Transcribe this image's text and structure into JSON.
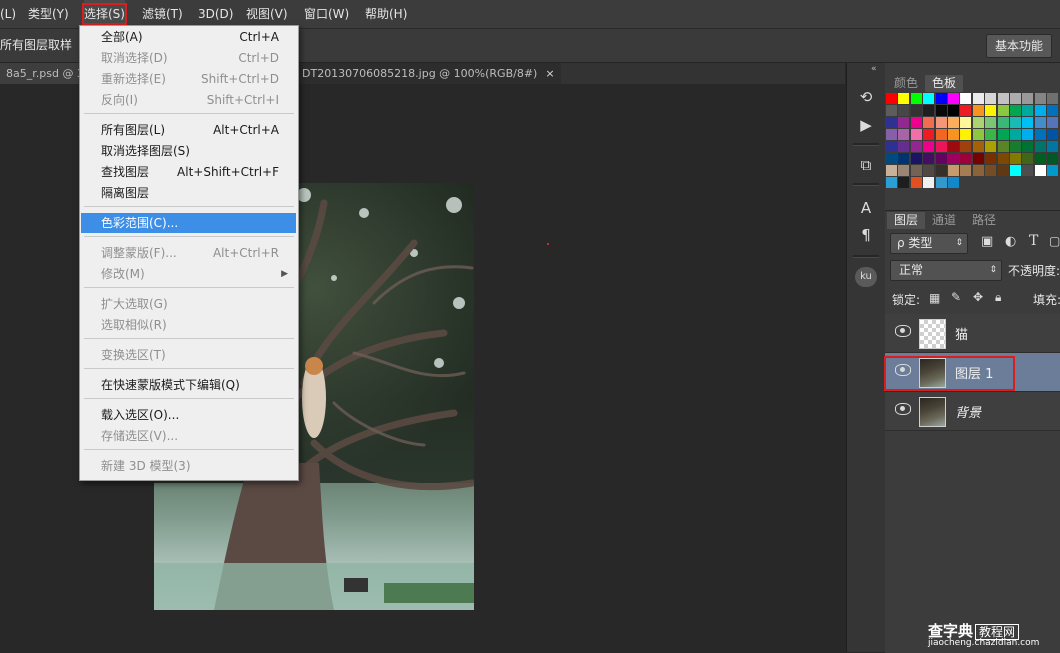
{
  "menubar": {
    "items": [
      "(L)",
      "类型(Y)",
      "选择(S)",
      "滤镜(T)",
      "3D(D)",
      "视图(V)",
      "窗口(W)",
      "帮助(H)"
    ]
  },
  "options_bar": {
    "label": "所有图层取样",
    "workspace_button": "基本功能"
  },
  "doc_tabs": [
    {
      "label": "8a5_r.psd @ 33"
    },
    {
      "label": "DT20130706085218.jpg @ 100%(RGB/8#)",
      "close": "×"
    }
  ],
  "select_menu": {
    "items": [
      {
        "label": "全部(A)",
        "shortcut": "Ctrl+A",
        "enabled": true
      },
      {
        "label": "取消选择(D)",
        "shortcut": "Ctrl+D",
        "enabled": false
      },
      {
        "label": "重新选择(E)",
        "shortcut": "Shift+Ctrl+D",
        "enabled": false
      },
      {
        "label": "反向(I)",
        "shortcut": "Shift+Ctrl+I",
        "enabled": false
      },
      {
        "label": "所有图层(L)",
        "shortcut": "Alt+Ctrl+A",
        "enabled": true
      },
      {
        "label": "取消选择图层(S)",
        "shortcut": "",
        "enabled": true
      },
      {
        "label": "查找图层",
        "shortcut": "Alt+Shift+Ctrl+F",
        "enabled": true
      },
      {
        "label": "隔离图层",
        "shortcut": "",
        "enabled": true
      },
      {
        "label": "色彩范围(C)...",
        "shortcut": "",
        "enabled": true,
        "highlighted": true
      },
      {
        "label": "调整蒙版(F)...",
        "shortcut": "Alt+Ctrl+R",
        "enabled": false
      },
      {
        "label": "修改(M)",
        "shortcut": "",
        "enabled": false,
        "submenu": true
      },
      {
        "label": "扩大选取(G)",
        "shortcut": "",
        "enabled": false
      },
      {
        "label": "选取相似(R)",
        "shortcut": "",
        "enabled": false
      },
      {
        "label": "变换选区(T)",
        "shortcut": "",
        "enabled": false
      },
      {
        "label": "在快速蒙版模式下编辑(Q)",
        "shortcut": "",
        "enabled": true
      },
      {
        "label": "载入选区(O)...",
        "shortcut": "",
        "enabled": true
      },
      {
        "label": "存储选区(V)...",
        "shortcut": "",
        "enabled": false
      },
      {
        "label": "新建 3D 模型(3)",
        "shortcut": "",
        "enabled": false
      }
    ]
  },
  "swatch_panel": {
    "tabs": [
      "颜色",
      "色板"
    ],
    "active_tab": "色板"
  },
  "layers_panel": {
    "tabs": [
      "图层",
      "通道",
      "路径"
    ],
    "filter_label": "ρ 类型",
    "blend_mode": "正常",
    "opacity_label": "不透明度:",
    "lock_label": "锁定:",
    "fill_label": "填充:",
    "layers": [
      {
        "name": "猫",
        "thumb": "transparent"
      },
      {
        "name": "图层 1",
        "thumb": "photo",
        "selected": true
      },
      {
        "name": "背景",
        "thumb": "photo"
      }
    ]
  },
  "icons": {
    "strip": [
      "history-icon",
      "play-icon",
      "3d-icon",
      "character-icon",
      "paragraph-icon",
      "kuler-icon"
    ]
  },
  "watermark": {
    "main": "查字典",
    "box": "教程网",
    "url": "jiaocheng.chazidian.com"
  },
  "colors": {
    "accent": "#3d8ee6",
    "highlight_border": "#d81e1e",
    "selected_layer": "#6b7d99"
  }
}
